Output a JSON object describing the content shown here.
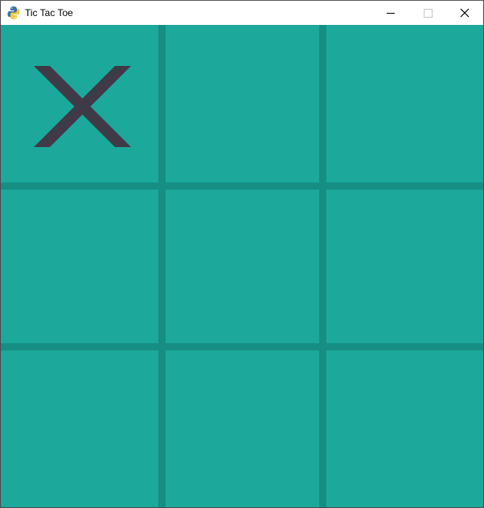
{
  "window": {
    "title": "Tic Tac Toe",
    "app_icon": "python-icon",
    "controls": [
      "minimize-icon",
      "maximize-icon",
      "close-icon"
    ]
  },
  "colors": {
    "board": "#1ca99c",
    "grid_lines": "#168e84",
    "x_mark": "#3f3a47",
    "titlebar": "#ffffff"
  },
  "board": {
    "rows": 3,
    "cols": 3,
    "cells": [
      [
        "X",
        "",
        ""
      ],
      [
        "",
        "",
        ""
      ],
      [
        "",
        "",
        ""
      ]
    ]
  }
}
